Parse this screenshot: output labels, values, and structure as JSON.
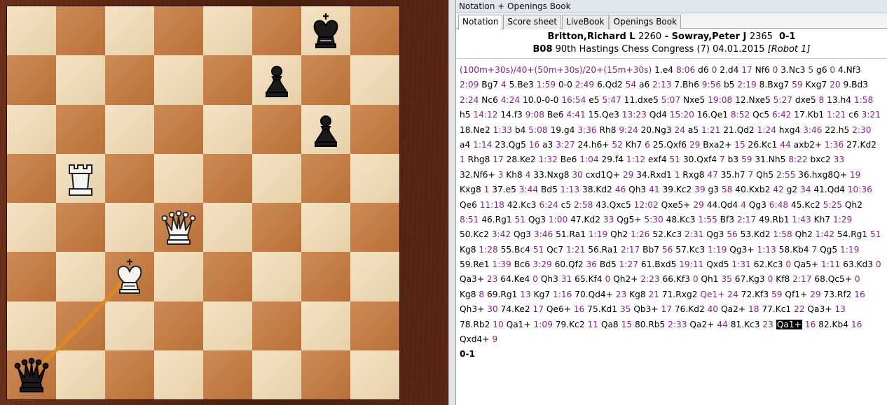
{
  "panel": {
    "title": "Notation + Openings Book",
    "tabs": [
      "Notation",
      "Score sheet",
      "LiveBook",
      "Openings Book"
    ]
  },
  "game": {
    "white": "Britton,Richard L",
    "white_elo": "2260",
    "separator": " - ",
    "black": "Sowray,Peter J",
    "black_elo": "2365",
    "result": "0-1",
    "eco": "B08",
    "event": "90th Hastings Chess Congress (7) 04.01.2015",
    "round_tag": "[Robot 1]"
  },
  "notation_lines": [
    [
      [
        "t",
        "(100m+30s)/40+(50m+30s)/20+(15m+30s)"
      ],
      [
        "m",
        " 1.e4 "
      ],
      [
        "t",
        "8:06"
      ],
      [
        "m",
        "  d6 "
      ],
      [
        "t",
        "0"
      ],
      [
        "m",
        "  2.d4 "
      ],
      [
        "t",
        "17"
      ],
      [
        "m",
        "  Nf6 "
      ],
      [
        "t",
        "0"
      ],
      [
        "m",
        "  3.Nc3 "
      ],
      [
        "t",
        "5"
      ],
      [
        "m",
        "  g6 "
      ],
      [
        "t",
        "0"
      ],
      [
        "m",
        "  4.Nf3"
      ]
    ],
    [
      [
        "t",
        "2:09"
      ],
      [
        "m",
        "  Bg7 "
      ],
      [
        "t",
        "4"
      ],
      [
        "m",
        "  5.Be3 "
      ],
      [
        "t",
        "1:59"
      ],
      [
        "m",
        "  0-0 "
      ],
      [
        "t",
        "2:49"
      ],
      [
        "m",
        "  6.Qd2 "
      ],
      [
        "t",
        "54"
      ],
      [
        "m",
        "  a6 "
      ],
      [
        "t",
        "2:13"
      ],
      [
        "m",
        "  7.Bh6 "
      ],
      [
        "t",
        "9:56"
      ],
      [
        "m",
        "  b5 "
      ],
      [
        "t",
        "2:19"
      ],
      [
        "m",
        "  8.Bxg7 "
      ],
      [
        "t",
        "59"
      ],
      [
        "m",
        "  Kxg7 "
      ],
      [
        "t",
        "20"
      ],
      [
        "m",
        "  9.Bd3"
      ]
    ],
    [
      [
        "t",
        "2:24"
      ],
      [
        "m",
        "  Nc6 "
      ],
      [
        "t",
        "4:24"
      ],
      [
        "m",
        "  10.0-0-0 "
      ],
      [
        "t",
        "16:54"
      ],
      [
        "m",
        "  e5 "
      ],
      [
        "t",
        "5:47"
      ],
      [
        "m",
        "  11.dxe5 "
      ],
      [
        "t",
        "5:07"
      ],
      [
        "m",
        "  Nxe5 "
      ],
      [
        "t",
        "19:08"
      ],
      [
        "m",
        "  12.Nxe5 "
      ],
      [
        "t",
        "5:27"
      ],
      [
        "m",
        "  dxe5 "
      ],
      [
        "t",
        "8"
      ],
      [
        "m",
        "  13.h4 "
      ],
      [
        "t",
        "1:58"
      ]
    ],
    [
      [
        "m",
        "h5 "
      ],
      [
        "t",
        "14:12"
      ],
      [
        "m",
        "  14.f3 "
      ],
      [
        "t",
        "9:08"
      ],
      [
        "m",
        "  Be6 "
      ],
      [
        "t",
        "4:41"
      ],
      [
        "m",
        "  15.Qe3 "
      ],
      [
        "t",
        "13:23"
      ],
      [
        "m",
        "  Qd4 "
      ],
      [
        "t",
        "15:20"
      ],
      [
        "m",
        "  16.Qe1 "
      ],
      [
        "t",
        "8:52"
      ],
      [
        "m",
        "  Qc5 "
      ],
      [
        "t",
        "6:42"
      ],
      [
        "m",
        "  17.Kb1 "
      ],
      [
        "t",
        "1:21"
      ],
      [
        "m",
        "  c6 "
      ],
      [
        "t",
        "3:21"
      ]
    ],
    [
      [
        "m",
        "18.Ne2 "
      ],
      [
        "t",
        "1:33"
      ],
      [
        "m",
        "  b4 "
      ],
      [
        "t",
        "5:08"
      ],
      [
        "m",
        "  19.g4 "
      ],
      [
        "t",
        "3:36"
      ],
      [
        "m",
        "  Rh8 "
      ],
      [
        "t",
        "9:24"
      ],
      [
        "m",
        "  20.Ng3 "
      ],
      [
        "t",
        "24"
      ],
      [
        "m",
        "  a5 "
      ],
      [
        "t",
        "1:21"
      ],
      [
        "m",
        "  21.Qd2 "
      ],
      [
        "t",
        "1:24"
      ],
      [
        "m",
        "  hxg4 "
      ],
      [
        "t",
        "3:46"
      ],
      [
        "m",
        "  22.h5 "
      ],
      [
        "t",
        "2:30"
      ]
    ],
    [
      [
        "m",
        "a4 "
      ],
      [
        "t",
        "1:14"
      ],
      [
        "m",
        "  23.Qg5 "
      ],
      [
        "t",
        "16"
      ],
      [
        "m",
        "  a3 "
      ],
      [
        "t",
        "3:27"
      ],
      [
        "m",
        "  24.h6+ "
      ],
      [
        "t",
        "52"
      ],
      [
        "m",
        "  Kh7 "
      ],
      [
        "t",
        "6"
      ],
      [
        "m",
        "  25.Qxf6 "
      ],
      [
        "t",
        "29"
      ],
      [
        "m",
        "  Bxa2+ "
      ],
      [
        "t",
        "15"
      ],
      [
        "m",
        "  26.Kc1 "
      ],
      [
        "t",
        "44"
      ],
      [
        "m",
        "  axb2+ "
      ],
      [
        "t",
        "1:36"
      ],
      [
        "m",
        "  27.Kd2"
      ]
    ],
    [
      [
        "t",
        "1"
      ],
      [
        "m",
        "  Rhg8 "
      ],
      [
        "t",
        "17"
      ],
      [
        "m",
        "  28.Ke2 "
      ],
      [
        "t",
        "1:32"
      ],
      [
        "m",
        "  Be6 "
      ],
      [
        "t",
        "1:04"
      ],
      [
        "m",
        "  29.f4 "
      ],
      [
        "t",
        "1:12"
      ],
      [
        "m",
        "  exf4 "
      ],
      [
        "t",
        "51"
      ],
      [
        "m",
        "  30.Qxf4 "
      ],
      [
        "t",
        "7"
      ],
      [
        "m",
        "  b3 "
      ],
      [
        "t",
        "59"
      ],
      [
        "m",
        "  31.Nh5 "
      ],
      [
        "t",
        "8:22"
      ],
      [
        "m",
        "  bxc2 "
      ],
      [
        "t",
        "33"
      ]
    ],
    [
      [
        "m",
        "32.Nf6+ "
      ],
      [
        "t",
        "3"
      ],
      [
        "m",
        "  Kh8 "
      ],
      [
        "t",
        "4"
      ],
      [
        "m",
        "  33.Nxg8 "
      ],
      [
        "t",
        "30"
      ],
      [
        "m",
        "  cxd1Q+ "
      ],
      [
        "t",
        "29"
      ],
      [
        "m",
        "  34.Rxd1 "
      ],
      [
        "t",
        "1"
      ],
      [
        "m",
        "  Rxg8 "
      ],
      [
        "t",
        "47"
      ],
      [
        "m",
        "  35.h7 "
      ],
      [
        "t",
        "7"
      ],
      [
        "m",
        "  Qh5 "
      ],
      [
        "t",
        "2:55"
      ],
      [
        "m",
        "  36.hxg8Q+ "
      ],
      [
        "t",
        "19"
      ]
    ],
    [
      [
        "m",
        "Kxg8 "
      ],
      [
        "t",
        "1"
      ],
      [
        "m",
        "  37.e5 "
      ],
      [
        "t",
        "3:44"
      ],
      [
        "m",
        "  Bd5 "
      ],
      [
        "t",
        "1:13"
      ],
      [
        "m",
        "  38.Kd2 "
      ],
      [
        "t",
        "46"
      ],
      [
        "m",
        "  Qh3 "
      ],
      [
        "t",
        "41"
      ],
      [
        "m",
        "  39.Kc2 "
      ],
      [
        "t",
        "39"
      ],
      [
        "m",
        "  g3 "
      ],
      [
        "t",
        "58"
      ],
      [
        "m",
        "  40.Kxb2 "
      ],
      [
        "t",
        "42"
      ],
      [
        "m",
        "  g2 "
      ],
      [
        "t",
        "34"
      ],
      [
        "m",
        "  41.Qd4 "
      ],
      [
        "t",
        "10:36"
      ]
    ],
    [
      [
        "m",
        "Qe6 "
      ],
      [
        "t",
        "11:18"
      ],
      [
        "m",
        "  42.Kc3 "
      ],
      [
        "t",
        "6:24"
      ],
      [
        "m",
        "  c5 "
      ],
      [
        "t",
        "2:58"
      ],
      [
        "m",
        "  43.Qxc5 "
      ],
      [
        "t",
        "12:02"
      ],
      [
        "m",
        "  Qxe5+ "
      ],
      [
        "t",
        "29"
      ],
      [
        "m",
        "  44.Qd4 "
      ],
      [
        "t",
        "4"
      ],
      [
        "m",
        "  Qg3 "
      ],
      [
        "t",
        "6:48"
      ],
      [
        "m",
        "  45.Kc2 "
      ],
      [
        "t",
        "5:25"
      ],
      [
        "m",
        "  Qh2"
      ]
    ],
    [
      [
        "t",
        "8:51"
      ],
      [
        "m",
        "  46.Rg1 "
      ],
      [
        "t",
        "51"
      ],
      [
        "m",
        "  Qg3 "
      ],
      [
        "t",
        "1:00"
      ],
      [
        "m",
        "  47.Kd2 "
      ],
      [
        "t",
        "33"
      ],
      [
        "m",
        "  Qg5+ "
      ],
      [
        "t",
        "5:30"
      ],
      [
        "m",
        "  48.Kc3 "
      ],
      [
        "t",
        "1:55"
      ],
      [
        "m",
        "  Bf3 "
      ],
      [
        "t",
        "2:17"
      ],
      [
        "m",
        "  49.Rb1 "
      ],
      [
        "t",
        "1:43"
      ],
      [
        "m",
        "  Kh7 "
      ],
      [
        "t",
        "1:29"
      ]
    ],
    [
      [
        "m",
        "50.Kc2 "
      ],
      [
        "t",
        "3:42"
      ],
      [
        "m",
        "  Qg3 "
      ],
      [
        "t",
        "3:46"
      ],
      [
        "m",
        "  51.Ra1 "
      ],
      [
        "t",
        "1:19"
      ],
      [
        "m",
        "  Qh2 "
      ],
      [
        "t",
        "1:26"
      ],
      [
        "m",
        "  52.Kc3 "
      ],
      [
        "t",
        "2:31"
      ],
      [
        "m",
        "  Qg3 "
      ],
      [
        "t",
        "56"
      ],
      [
        "m",
        "  53.Kd2 "
      ],
      [
        "t",
        "1:58"
      ],
      [
        "m",
        "  Qh2 "
      ],
      [
        "t",
        "1:42"
      ],
      [
        "m",
        "  54.Rg1 "
      ],
      [
        "t",
        "51"
      ]
    ],
    [
      [
        "m",
        "Kg8 "
      ],
      [
        "t",
        "1:28"
      ],
      [
        "m",
        "  55.Bc4 "
      ],
      [
        "t",
        "51"
      ],
      [
        "m",
        "  Qc7 "
      ],
      [
        "t",
        "1:21"
      ],
      [
        "m",
        "  56.Ra1 "
      ],
      [
        "t",
        "2:17"
      ],
      [
        "m",
        "  Bb7 "
      ],
      [
        "t",
        "56"
      ],
      [
        "m",
        "  57.Kc3 "
      ],
      [
        "t",
        "1:19"
      ],
      [
        "m",
        "  Qg3+ "
      ],
      [
        "t",
        "1:13"
      ],
      [
        "m",
        "  58.Kb4 "
      ],
      [
        "t",
        "7"
      ],
      [
        "m",
        "  Qg5 "
      ],
      [
        "t",
        "1:19"
      ]
    ],
    [
      [
        "m",
        "59.Re1 "
      ],
      [
        "t",
        "1:39"
      ],
      [
        "m",
        "  Bc6 "
      ],
      [
        "t",
        "3:29"
      ],
      [
        "m",
        "  60.Qf2 "
      ],
      [
        "t",
        "36"
      ],
      [
        "m",
        "  Bd5 "
      ],
      [
        "t",
        "1:27"
      ],
      [
        "m",
        "  61.Bxd5 "
      ],
      [
        "t",
        "19:11"
      ],
      [
        "m",
        "  Qxd5 "
      ],
      [
        "t",
        "1:31"
      ],
      [
        "m",
        "  62.Kc3 "
      ],
      [
        "t",
        "0"
      ],
      [
        "m",
        "  Qa5+ "
      ],
      [
        "t",
        "1:11"
      ],
      [
        "m",
        "  63.Kd3 "
      ],
      [
        "t",
        "0"
      ]
    ],
    [
      [
        "m",
        "Qa3+ "
      ],
      [
        "t",
        "23"
      ],
      [
        "m",
        "  64.Ke4 "
      ],
      [
        "t",
        "0"
      ],
      [
        "m",
        "  Qh3 "
      ],
      [
        "t",
        "31"
      ],
      [
        "m",
        "  65.Kf4 "
      ],
      [
        "t",
        "0"
      ],
      [
        "m",
        "  Qh2+ "
      ],
      [
        "t",
        "2:23"
      ],
      [
        "m",
        "  66.Kf3 "
      ],
      [
        "t",
        "0"
      ],
      [
        "m",
        "  Qh1 "
      ],
      [
        "t",
        "35"
      ],
      [
        "m",
        "  67.Kg3 "
      ],
      [
        "t",
        "0"
      ],
      [
        "m",
        "  Kf8 "
      ],
      [
        "t",
        "2:17"
      ],
      [
        "m",
        "  68.Qc5+ "
      ],
      [
        "t",
        "0"
      ]
    ],
    [
      [
        "m",
        "Kg8 "
      ],
      [
        "t",
        "8"
      ],
      [
        "m",
        "  69.Rg1 "
      ],
      [
        "t",
        "13"
      ],
      [
        "m",
        "  Kg7 "
      ],
      [
        "t",
        "1:16"
      ],
      [
        "m",
        "  70.Qd4+ "
      ],
      [
        "t",
        "23"
      ],
      [
        "m",
        "  Kg8 "
      ],
      [
        "t",
        "21"
      ],
      [
        "m",
        "  71.Rxg2 "
      ],
      [
        "t",
        "Qe1+ "
      ],
      [
        "t",
        "24"
      ],
      [
        "m",
        "  72.Kf3 "
      ],
      [
        "t",
        "59"
      ],
      [
        "m",
        "  Qf1+ "
      ],
      [
        "t",
        "29"
      ],
      [
        "m",
        "  73.Rf2 "
      ],
      [
        "t",
        "16"
      ]
    ],
    [
      [
        "m",
        "Qh3+ "
      ],
      [
        "t",
        "30"
      ],
      [
        "m",
        "  74.Ke2 "
      ],
      [
        "t",
        "17"
      ],
      [
        "m",
        "  Qe6+ "
      ],
      [
        "t",
        "16"
      ],
      [
        "m",
        "  75.Kd1 "
      ],
      [
        "t",
        "35"
      ],
      [
        "m",
        "  Qb3+ "
      ],
      [
        "t",
        "17"
      ],
      [
        "m",
        "  76.Kd2 "
      ],
      [
        "t",
        "40"
      ],
      [
        "m",
        "  Qa2+ "
      ],
      [
        "t",
        "18"
      ],
      [
        "m",
        "  77.Kc1 "
      ],
      [
        "t",
        "22"
      ],
      [
        "m",
        "  Qa3+ "
      ],
      [
        "t",
        "13"
      ]
    ],
    [
      [
        "m",
        "78.Rb2 "
      ],
      [
        "t",
        "10"
      ],
      [
        "m",
        "  Qa1+ "
      ],
      [
        "t",
        "1:09"
      ],
      [
        "m",
        "  79.Kc2 "
      ],
      [
        "t",
        "11"
      ],
      [
        "m",
        "  Qa8 "
      ],
      [
        "t",
        "15"
      ],
      [
        "m",
        "  80.Rb5 "
      ],
      [
        "t",
        "2:33"
      ],
      [
        "m",
        "  Qa2+ "
      ],
      [
        "t",
        "44"
      ],
      [
        "m",
        "  81.Kc3 "
      ],
      [
        "t",
        "23"
      ],
      [
        "m",
        "  "
      ],
      [
        "h",
        "Qa1+"
      ],
      [
        "m",
        " "
      ],
      [
        "t",
        "16"
      ],
      [
        "m",
        "  82.Kb4 "
      ],
      [
        "t",
        "16"
      ]
    ],
    [
      [
        "m",
        "Qxd4+ "
      ],
      [
        "t",
        "9"
      ]
    ]
  ],
  "final_result": "0-1",
  "board": {
    "light_color": "#f0d9b0",
    "dark_color": "#c87a3c",
    "pieces": [
      {
        "name": "black-king-icon",
        "color": "black",
        "type": "king",
        "square": "g8"
      },
      {
        "name": "black-pawn-icon",
        "color": "black",
        "type": "pawn",
        "square": "f7"
      },
      {
        "name": "black-pawn-icon",
        "color": "black",
        "type": "pawn",
        "square": "g6"
      },
      {
        "name": "white-rook-icon",
        "color": "white",
        "type": "rook",
        "square": "b5"
      },
      {
        "name": "white-queen-icon",
        "color": "white",
        "type": "queen",
        "square": "d4"
      },
      {
        "name": "white-king-icon",
        "color": "white",
        "type": "king",
        "square": "c3"
      },
      {
        "name": "black-queen-icon",
        "color": "black",
        "type": "queen",
        "square": "a1"
      }
    ],
    "last_move_arrow": {
      "from": "a1",
      "to": "c3",
      "color": "#e08a1e"
    }
  }
}
